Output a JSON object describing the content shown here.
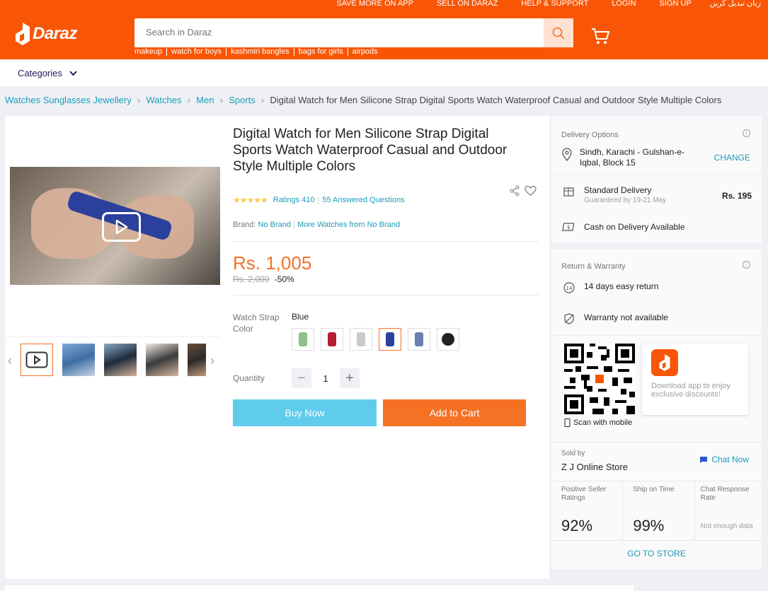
{
  "header": {
    "top_links": [
      "SAVE MORE ON APP",
      "SELL ON DARAZ",
      "HELP & SUPPORT",
      "LOGIN",
      "SIGN UP"
    ],
    "urdu_link": "زبان تبدیل کریں",
    "logo_text": "Daraz",
    "search_placeholder": "Search in Daraz",
    "suggestions": [
      "makeup",
      "watch for boys",
      "kashmiri bangles",
      "bags for girls",
      "airpods"
    ],
    "brand_color": "#f85606"
  },
  "categories_label": "Categories",
  "breadcrumb": [
    "Watches Sunglasses Jewellery",
    "Watches",
    "Men",
    "Sports"
  ],
  "breadcrumb_current": "Digital Watch for Men Silicone Strap Digital Sports Watch Waterproof Casual and Outdoor Style Multiple Colors",
  "product": {
    "title": "Digital Watch for Men Silicone Strap Digital Sports Watch Waterproof Casual and Outdoor Style Multiple Colors",
    "ratings": "Ratings 410",
    "answered": "55 Answered Questions",
    "brand_label": "Brand:",
    "brand_value": "No Brand",
    "more_from": "More Watches from No Brand",
    "price": "Rs. 1,005",
    "old_price": "Rs. 2,000",
    "discount": "-50%",
    "variant_label": "Watch Strap Color",
    "variant_value": "Blue",
    "swatch_colors": [
      "#8fbf8a",
      "#b3202f",
      "#c9c9c9",
      "#2b3f9c",
      "#6a7fb0",
      "#222222"
    ],
    "quantity_label": "Quantity",
    "quantity": "1",
    "buy_now": "Buy Now",
    "add_to_cart": "Add to Cart"
  },
  "delivery": {
    "heading": "Delivery Options",
    "location": "Sindh, Karachi - Gulshan-e-Iqbal, Block 15",
    "change": "CHANGE",
    "standard": "Standard Delivery",
    "guaranteed": "Guaranteed by 19-21 May",
    "fee": "Rs. 195",
    "cod": "Cash on Delivery Available"
  },
  "returns": {
    "heading": "Return & Warranty",
    "return": "14 days easy return",
    "warranty": "Warranty not available"
  },
  "app": {
    "promo": "Download app to enjoy exclusive discounts!",
    "scan": "Scan with mobile"
  },
  "seller": {
    "sold_by": "Sold by",
    "name": "Z J Online Store",
    "chat": "Chat Now",
    "positive_label": "Positive Seller Ratings",
    "positive_value": "92%",
    "ship_label": "Ship on Time",
    "ship_value": "99%",
    "chat_label": "Chat Response Rate",
    "chat_value": "Not enough data",
    "go_store": "GO TO STORE"
  }
}
